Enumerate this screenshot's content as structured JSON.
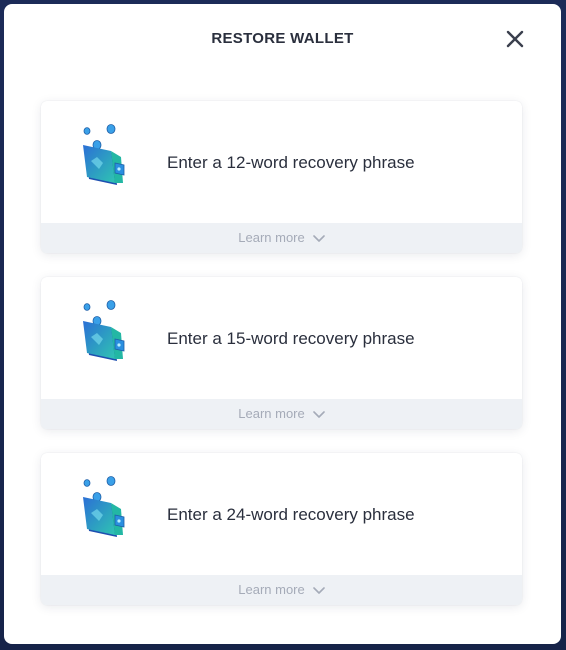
{
  "modal": {
    "title": "RESTORE WALLET",
    "close_icon": "close-icon"
  },
  "options": [
    {
      "label": "Enter a 12-word recovery phrase",
      "icon": "wallet-icon",
      "learn_more": "Learn more"
    },
    {
      "label": "Enter a 15-word recovery phrase",
      "icon": "wallet-icon",
      "learn_more": "Learn more"
    },
    {
      "label": "Enter a 24-word recovery phrase",
      "icon": "wallet-icon",
      "learn_more": "Learn more"
    }
  ],
  "colors": {
    "backdrop": "#1b2a55",
    "wallet_teal": "#2fc4b2",
    "wallet_blue": "#2b6fd6",
    "coin": "#3aa0e8",
    "footer_bg": "#eef1f5",
    "muted_text": "#a5abb8"
  }
}
